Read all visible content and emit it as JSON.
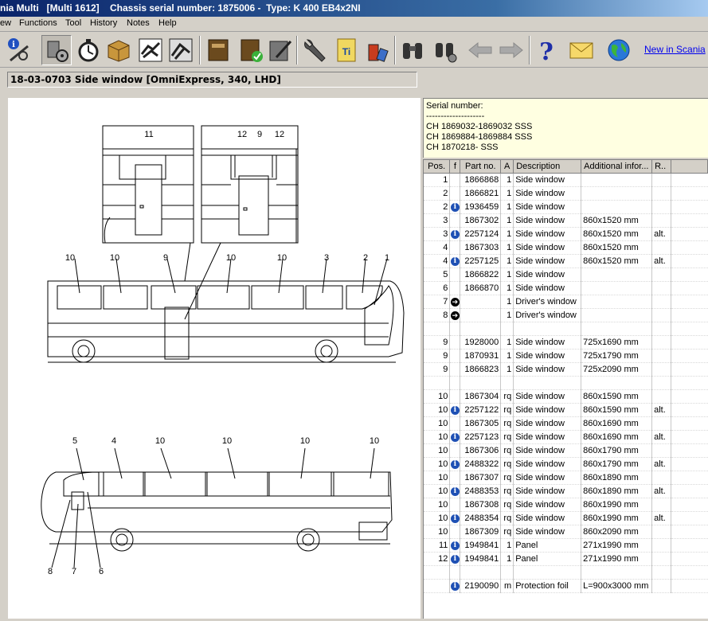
{
  "window": {
    "title": "nia Multi   [Multi 1612]    Chassis serial number: 1875006 -  Type: K 400 EB4x2NI"
  },
  "menu": [
    "ew",
    "Functions",
    "Tool",
    "History",
    "Notes",
    "Help"
  ],
  "toolbar": {
    "icons": [
      "info-tools-icon",
      "engine-gear-icon",
      "stopwatch-icon",
      "parts-box-icon",
      "handshake-icon",
      "manual-icon",
      "book-icon",
      "book-check-icon",
      "notepad-pen-icon",
      "wrench-icon",
      "ti-document-icon",
      "oil-can-icon",
      "binoculars-icon",
      "binoculars-advanced-icon",
      "back-arrow-icon",
      "forward-arrow-icon",
      "help-icon",
      "mail-icon",
      "globe-icon"
    ],
    "new_link": "New in Scania"
  },
  "path": "18-03-0703 Side window [OmniExpress, 340, LHD]",
  "drawing": {
    "detail_left_label": "11",
    "detail_right_labels": [
      "12",
      "9",
      "12"
    ],
    "top_bus_labels": [
      "10",
      "10",
      "9",
      "10",
      "10",
      "3",
      "2",
      "1"
    ],
    "bottom_bus_top_labels": [
      "5",
      "4",
      "10",
      "10",
      "10",
      "10"
    ],
    "bottom_bus_bottom_labels": [
      "8",
      "7",
      "6"
    ]
  },
  "serial": {
    "label": "Serial number:",
    "divider": "--------------------",
    "lines": [
      "CH 1869032-1869032 SSS",
      "CH 1869884-1869884 SSS",
      "CH 1870218- SSS"
    ]
  },
  "table": {
    "headers": [
      "Pos.",
      "f",
      "Part no.",
      "A",
      "Description",
      "Additional infor...",
      "R.."
    ],
    "rows": [
      {
        "pos": "1",
        "flag": "",
        "part": "1866868",
        "a": "1",
        "desc": "Side window",
        "info": "",
        "r": ""
      },
      {
        "pos": "2",
        "flag": "",
        "part": "1866821",
        "a": "1",
        "desc": "Side window",
        "info": "",
        "r": ""
      },
      {
        "pos": "2",
        "flag": "i",
        "part": "1936459",
        "a": "1",
        "desc": "Side window",
        "info": "",
        "r": ""
      },
      {
        "pos": "3",
        "flag": "",
        "part": "1867302",
        "a": "1",
        "desc": "Side window",
        "info": "860x1520 mm",
        "r": ""
      },
      {
        "pos": "3",
        "flag": "i",
        "part": "2257124",
        "a": "1",
        "desc": "Side window",
        "info": "860x1520 mm",
        "r": "alt."
      },
      {
        "pos": "4",
        "flag": "",
        "part": "1867303",
        "a": "1",
        "desc": "Side window",
        "info": "860x1520 mm",
        "r": ""
      },
      {
        "pos": "4",
        "flag": "i",
        "part": "2257125",
        "a": "1",
        "desc": "Side window",
        "info": "860x1520 mm",
        "r": "alt."
      },
      {
        "pos": "5",
        "flag": "",
        "part": "1866822",
        "a": "1",
        "desc": "Side window",
        "info": "",
        "r": ""
      },
      {
        "pos": "6",
        "flag": "",
        "part": "1866870",
        "a": "1",
        "desc": "Side window",
        "info": "",
        "r": ""
      },
      {
        "pos": "7",
        "flag": "arrow",
        "part": "",
        "a": "1",
        "desc": "Driver's window",
        "info": "",
        "r": ""
      },
      {
        "pos": "8",
        "flag": "arrow",
        "part": "",
        "a": "1",
        "desc": "Driver's window",
        "info": "",
        "r": ""
      },
      {
        "pos": "",
        "flag": "",
        "part": "",
        "a": "",
        "desc": "",
        "info": "",
        "r": ""
      },
      {
        "pos": "9",
        "flag": "",
        "part": "1928000",
        "a": "1",
        "desc": "Side window",
        "info": "725x1690 mm",
        "r": ""
      },
      {
        "pos": "9",
        "flag": "",
        "part": "1870931",
        "a": "1",
        "desc": "Side window",
        "info": "725x1790 mm",
        "r": ""
      },
      {
        "pos": "9",
        "flag": "",
        "part": "1866823",
        "a": "1",
        "desc": "Side window",
        "info": "725x2090 mm",
        "r": ""
      },
      {
        "pos": "",
        "flag": "",
        "part": "",
        "a": "",
        "desc": "",
        "info": "",
        "r": ""
      },
      {
        "pos": "10",
        "flag": "",
        "part": "1867304",
        "a": "rq",
        "desc": "Side window",
        "info": "860x1590 mm",
        "r": ""
      },
      {
        "pos": "10",
        "flag": "i",
        "part": "2257122",
        "a": "rq",
        "desc": "Side window",
        "info": "860x1590 mm",
        "r": "alt."
      },
      {
        "pos": "10",
        "flag": "",
        "part": "1867305",
        "a": "rq",
        "desc": "Side window",
        "info": "860x1690 mm",
        "r": ""
      },
      {
        "pos": "10",
        "flag": "i",
        "part": "2257123",
        "a": "rq",
        "desc": "Side window",
        "info": "860x1690 mm",
        "r": "alt."
      },
      {
        "pos": "10",
        "flag": "",
        "part": "1867306",
        "a": "rq",
        "desc": "Side window",
        "info": "860x1790 mm",
        "r": ""
      },
      {
        "pos": "10",
        "flag": "i",
        "part": "2488322",
        "a": "rq",
        "desc": "Side window",
        "info": "860x1790 mm",
        "r": "alt."
      },
      {
        "pos": "10",
        "flag": "",
        "part": "1867307",
        "a": "rq",
        "desc": "Side window",
        "info": "860x1890 mm",
        "r": ""
      },
      {
        "pos": "10",
        "flag": "i",
        "part": "2488353",
        "a": "rq",
        "desc": "Side window",
        "info": "860x1890 mm",
        "r": "alt."
      },
      {
        "pos": "10",
        "flag": "",
        "part": "1867308",
        "a": "rq",
        "desc": "Side window",
        "info": "860x1990 mm",
        "r": ""
      },
      {
        "pos": "10",
        "flag": "i",
        "part": "2488354",
        "a": "rq",
        "desc": "Side window",
        "info": "860x1990 mm",
        "r": "alt."
      },
      {
        "pos": "10",
        "flag": "",
        "part": "1867309",
        "a": "rq",
        "desc": "Side window",
        "info": "860x2090 mm",
        "r": ""
      },
      {
        "pos": "11",
        "flag": "i",
        "part": "1949841",
        "a": "1",
        "desc": "Panel",
        "info": "271x1990 mm",
        "r": ""
      },
      {
        "pos": "12",
        "flag": "i",
        "part": "1949841",
        "a": "1",
        "desc": "Panel",
        "info": "271x1990 mm",
        "r": ""
      },
      {
        "pos": "",
        "flag": "",
        "part": "",
        "a": "",
        "desc": "",
        "info": "",
        "r": ""
      },
      {
        "pos": "",
        "flag": "i",
        "part": "2190090",
        "a": "m",
        "desc": "Protection foil",
        "info": "L=900x3000 mm",
        "r": ""
      }
    ]
  }
}
